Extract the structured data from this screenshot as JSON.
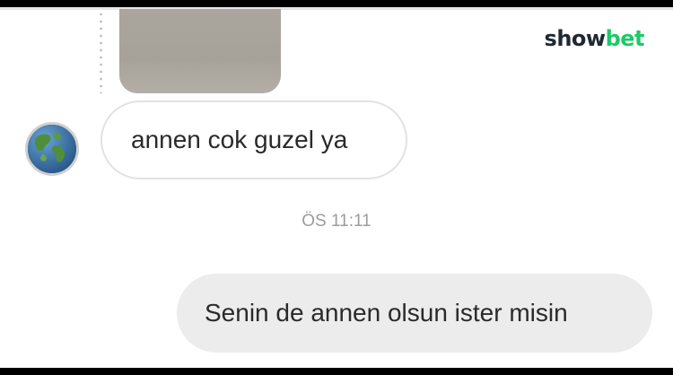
{
  "brand": {
    "part1": "show",
    "part2": "bet"
  },
  "messages": [
    {
      "direction": "incoming",
      "text": "annen cok guzel ya",
      "has_avatar": true,
      "avatar_icon": "globe-icon"
    },
    {
      "direction": "outgoing",
      "text": "Senin de annen olsun ister misin"
    }
  ],
  "timestamp": "ÖS 11:11",
  "colors": {
    "brand_dark": "#1f2933",
    "brand_green": "#1ec96a",
    "outgoing_bubble": "#ececec",
    "incoming_border": "#e2e2e2",
    "timestamp": "#9c9c9c"
  }
}
